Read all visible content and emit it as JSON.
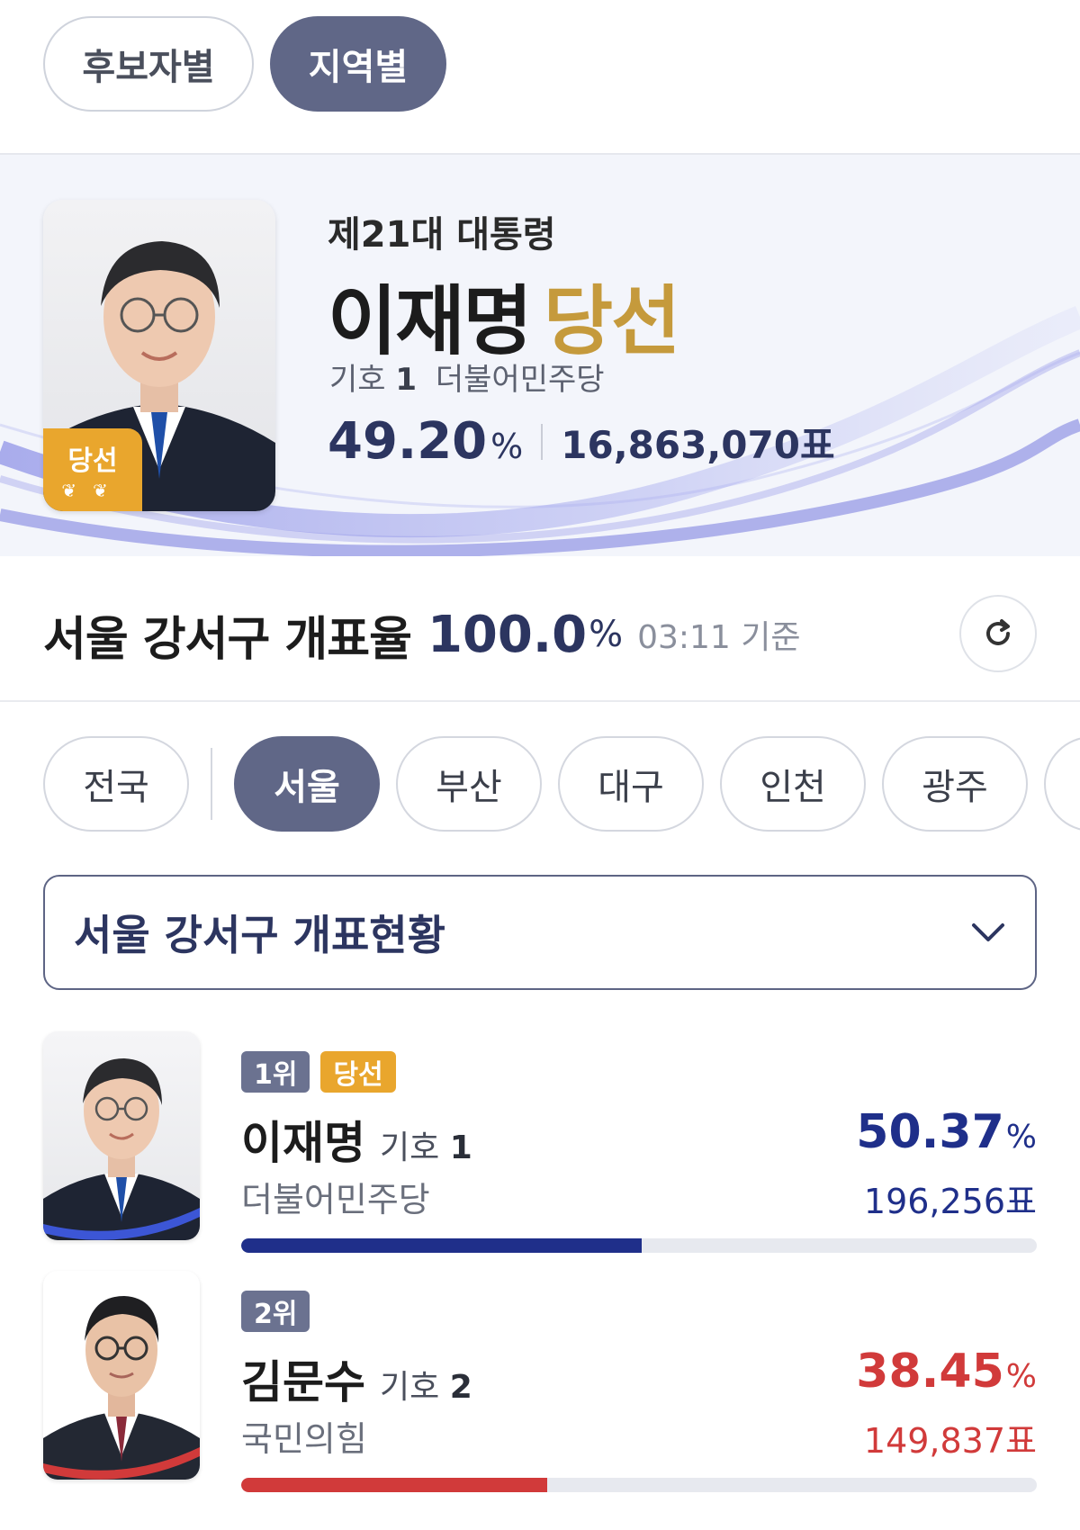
{
  "view_tabs": [
    {
      "label": "후보자별",
      "active": false
    },
    {
      "label": "지역별",
      "active": true
    }
  ],
  "hero": {
    "subtitle": "제21대 대통령",
    "name": "이재명",
    "status": "당선",
    "number_label": "기호",
    "number": "1",
    "party": "더불어민주당",
    "percent": "49.20",
    "percent_unit": "%",
    "votes": "16,863,070표",
    "photo_badge": "당선"
  },
  "count": {
    "title": "서울 강서구 개표율",
    "rate": "100.0",
    "unit": "%",
    "time": "03:11 기준",
    "refresh_icon": "refresh-icon"
  },
  "regions": [
    {
      "label": "전국",
      "active": false
    },
    {
      "label": "서울",
      "active": true
    },
    {
      "label": "부산",
      "active": false
    },
    {
      "label": "대구",
      "active": false
    },
    {
      "label": "인천",
      "active": false
    },
    {
      "label": "광주",
      "active": false
    }
  ],
  "dropdown": {
    "label": "서울 강서구 개표현황",
    "icon": "chevron-down-icon"
  },
  "candidates": [
    {
      "rank": "1위",
      "badge": "당선",
      "name": "이재명",
      "number_label": "기호",
      "number": "1",
      "party": "더불어민주당",
      "percent": "50.37",
      "percent_unit": "%",
      "votes": "196,256표",
      "color": "#1f2f8a",
      "share": 0.5037
    },
    {
      "rank": "2위",
      "badge": "",
      "name": "김문수",
      "number_label": "기호",
      "number": "2",
      "party": "국민의힘",
      "percent": "38.45",
      "percent_unit": "%",
      "votes": "149,837표",
      "color": "#d13a3a",
      "share": 0.3845
    }
  ],
  "colors": {
    "accent": "#606787",
    "navy": "#2c3560",
    "gold": "#c59a3c",
    "badge_gold": "#e9a62d",
    "red": "#d13a3a"
  }
}
